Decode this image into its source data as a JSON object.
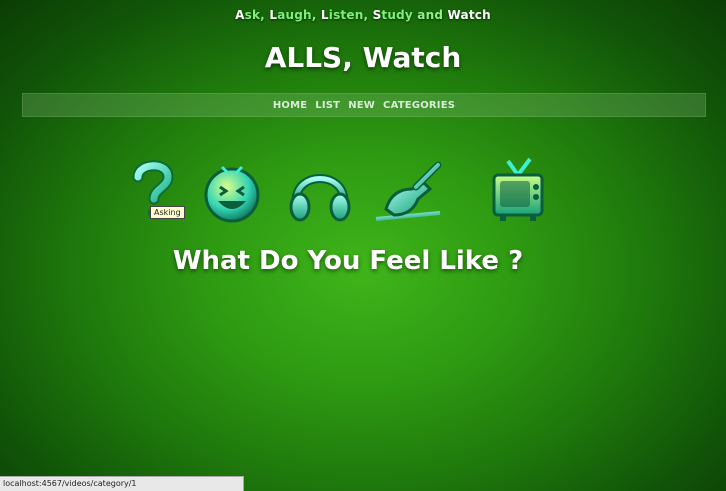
{
  "tagline": {
    "parts": [
      {
        "cap": "A",
        "rest": "sk, "
      },
      {
        "cap": "L",
        "rest": "augh, "
      },
      {
        "cap": "L",
        "rest": "isten, "
      },
      {
        "cap": "S",
        "rest": "tudy "
      },
      {
        "and": "and "
      },
      {
        "cap": "W",
        "rest": "atch"
      }
    ]
  },
  "site_title": "ALLS, Watch",
  "nav": {
    "home": "HOME",
    "list": "LIST",
    "new": "NEW",
    "categories": "CATEGORIES"
  },
  "icons": [
    {
      "name": "question-mark-icon"
    },
    {
      "name": "laughing-face-icon"
    },
    {
      "name": "headphones-icon"
    },
    {
      "name": "writing-hand-icon"
    },
    {
      "name": "television-icon"
    }
  ],
  "tooltip": "Asking",
  "question": "What Do You Feel Like ?",
  "status_url": "localhost:4567/videos/category/1",
  "colors": {
    "background": "#2e9a12",
    "icon_glow": "#3cf0d0",
    "nav_bar": "#8cbe82"
  }
}
